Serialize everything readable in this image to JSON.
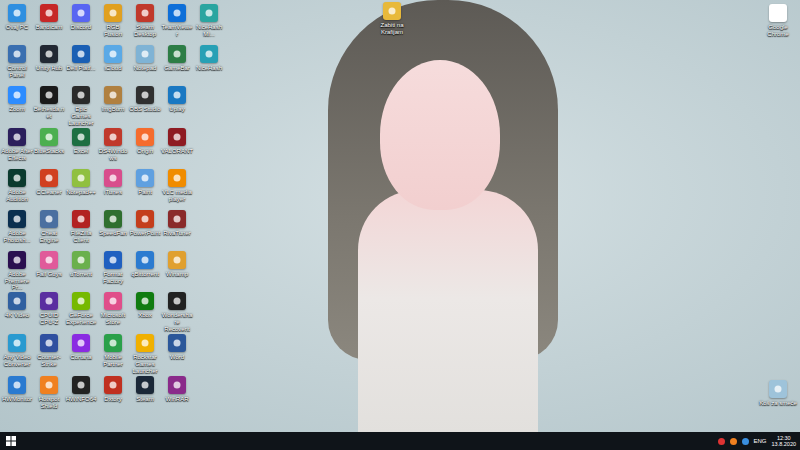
{
  "desktop": {
    "icon_rows": [
      [
        {
          "label": "Ovaj PC",
          "color": "#2f8fe0"
        },
        {
          "label": "Bandicam",
          "color": "#c62828"
        },
        {
          "label": "Discord",
          "color": "#5865f2"
        },
        {
          "label": "RGB Fusion",
          "color": "#e0a020"
        },
        {
          "label": "Steam Desktop",
          "color": "#c0392b"
        },
        {
          "label": "TeamViewer",
          "color": "#0e6fd8"
        },
        {
          "label": "NiceHash Mi...",
          "color": "#2aa5a0"
        }
      ],
      [
        {
          "label": "Control Panel",
          "color": "#3a6fb0"
        },
        {
          "label": "Unity Hub",
          "color": "#222833"
        },
        {
          "label": "Dell Platf...",
          "color": "#1a5fb4"
        },
        {
          "label": "iCloud",
          "color": "#5aa9e6"
        },
        {
          "label": "Notepad",
          "color": "#7fb3d5"
        },
        {
          "label": "GameBar",
          "color": "#2d7d46"
        },
        {
          "label": "NiceHash",
          "color": "#27a0b5"
        }
      ],
      [
        {
          "label": "Zoom",
          "color": "#2d8cff"
        },
        {
          "label": "Bethesda.net",
          "color": "#1a1a1a"
        },
        {
          "label": "Epic Games Launcher",
          "color": "#2a2a2a"
        },
        {
          "label": "ImgBurn",
          "color": "#b08040"
        },
        {
          "label": "OBS Studio",
          "color": "#303030"
        },
        {
          "label": "Uplay",
          "color": "#1a78c2"
        }
      ],
      [
        {
          "label": "Adobe After Effects",
          "color": "#2b1f5c"
        },
        {
          "label": "BlueStacks",
          "color": "#4caf50"
        },
        {
          "label": "Excel",
          "color": "#1d6f42"
        },
        {
          "label": "DS4Windows",
          "color": "#c0392b"
        },
        {
          "label": "Origin",
          "color": "#f56c2d"
        },
        {
          "label": "VALORANT",
          "color": "#8e1b22"
        }
      ],
      [
        {
          "label": "Adobe Audition",
          "color": "#0b3a2e"
        },
        {
          "label": "CCleaner",
          "color": "#d04020"
        },
        {
          "label": "Notepad++",
          "color": "#90c040"
        },
        {
          "label": "iTunes",
          "color": "#d84d8c"
        },
        {
          "label": "Paint",
          "color": "#5fa0e0"
        },
        {
          "label": "VLC media player",
          "color": "#f08c00"
        }
      ],
      [
        {
          "label": "Adobe Photosh...",
          "color": "#0b2f4f"
        },
        {
          "label": "Cheat Engine",
          "color": "#4a6fa0"
        },
        {
          "label": "FileZilla Client",
          "color": "#b22222"
        },
        {
          "label": "SpeedFan",
          "color": "#2f6f2f"
        },
        {
          "label": "PowerPoint",
          "color": "#c43e1c"
        },
        {
          "label": "RivaTuner",
          "color": "#8a2a2a"
        }
      ],
      [
        {
          "label": "Adobe Premiere Pr...",
          "color": "#2a0f4f"
        },
        {
          "label": "Fall Guys",
          "color": "#e05a9a"
        },
        {
          "label": "uTorrent",
          "color": "#6ab04c"
        },
        {
          "label": "Format Factory",
          "color": "#2060c0"
        },
        {
          "label": "qBittorrent",
          "color": "#2b7bd0"
        },
        {
          "label": "Winamp",
          "color": "#e0a030"
        }
      ],
      [
        {
          "label": "4K Video",
          "color": "#3060a0"
        },
        {
          "label": "CPUID CPU-Z",
          "color": "#5a2ea0"
        },
        {
          "label": "GeForce Experience",
          "color": "#76b900"
        },
        {
          "label": "Microsoft Store",
          "color": "#e04e8a"
        },
        {
          "label": "Xbox",
          "color": "#107c10"
        },
        {
          "label": "Wondershare Recoverit",
          "color": "#222222"
        }
      ],
      [
        {
          "label": "Any Video Converter",
          "color": "#2a9ad0"
        },
        {
          "label": "Counter-Strike",
          "color": "#3050a0"
        },
        {
          "label": "Cortana",
          "color": "#8a2be2"
        },
        {
          "label": "Mobile Partner",
          "color": "#2aa04a"
        },
        {
          "label": "Rockstar Games Launcher",
          "color": "#f0b000"
        },
        {
          "label": "Word",
          "color": "#2b579a"
        }
      ],
      [
        {
          "label": "HWMonitor",
          "color": "#2a7ad0"
        },
        {
          "label": "Hotspot Shield",
          "color": "#f08020"
        },
        {
          "label": "HWiNFO64",
          "color": "#222222"
        },
        {
          "label": "Dxtory",
          "color": "#c03020"
        },
        {
          "label": "Steam",
          "color": "#1b2838"
        },
        {
          "label": "WinRAR",
          "color": "#8a2a8a"
        }
      ]
    ],
    "folder": {
      "label": "Zabiti na Krafijam",
      "color": "#e8b93a"
    },
    "chrome": {
      "label": "Google Chrome",
      "color": "#ffffff"
    },
    "bin": {
      "label": "Koš za smeće",
      "color": "#9ec3da"
    }
  },
  "taskbar": {
    "language": "ENG",
    "time": "12:30",
    "date": "13.8.2020"
  }
}
